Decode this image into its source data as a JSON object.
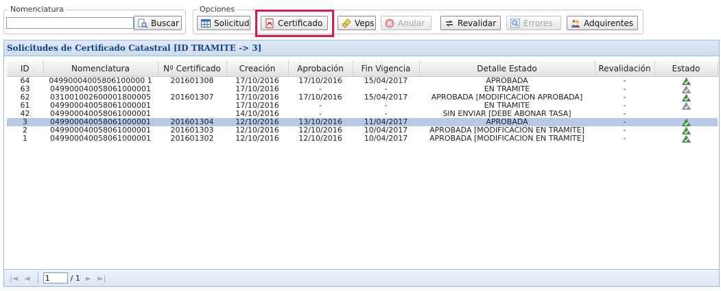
{
  "toolbar": {
    "nomenclatura_legend": "Nomenclatura",
    "nomenclatura_value": "",
    "buscar_label": "Buscar",
    "opciones_legend": "Opciones",
    "buttons": {
      "solicitud": "Solicitud",
      "certificado": "Certificado",
      "veps": "Veps",
      "anular": "Anular",
      "revalidar": "Revalidar",
      "errores": "Errores",
      "adquirentes": "Adquirentes"
    },
    "icons": {
      "buscar": "search-page-icon",
      "solicitud": "table-grid-icon",
      "certificado": "pdf-icon",
      "veps": "ticket-icon",
      "anular": "cancel-icon",
      "revalidar": "refresh-arrows-icon",
      "errores": "error-search-icon",
      "adquirentes": "users-icon"
    }
  },
  "panel": {
    "title": "Solicitudes de Certificado Catastral [ID TRAMITE -> 3]"
  },
  "grid": {
    "columns": [
      "ID",
      "Nomenclatura",
      "Nº Certificado",
      "Creación",
      "Aprobación",
      "Fin Vigencia",
      "Detalle Estado",
      "Revalidación",
      "Estado"
    ],
    "rows": [
      {
        "id": "64",
        "nomenclatura": "04990004005806100000 1",
        "certificado": "201601308",
        "creacion": "17/10/2016",
        "aprobacion": "17/10/2016",
        "fin_vigencia": "15/04/2017",
        "detalle": "APROBADA",
        "revalidacion": "-",
        "estado": "green",
        "selected": false
      },
      {
        "id": "63",
        "nomenclatura": "049900040058061000001",
        "certificado": "",
        "creacion": "17/10/2016",
        "aprobacion": "-",
        "fin_vigencia": "-",
        "detalle": "EN TRAMITE",
        "revalidacion": "-",
        "estado": "gray",
        "selected": false
      },
      {
        "id": "62",
        "nomenclatura": "031001002600001800005",
        "certificado": "201601307",
        "creacion": "17/10/2016",
        "aprobacion": "17/10/2016",
        "fin_vigencia": "15/04/2017",
        "detalle": "APROBADA [MODIFICACION APROBADA]",
        "revalidacion": "-",
        "estado": "green",
        "selected": false
      },
      {
        "id": "61",
        "nomenclatura": "049900040058061000001",
        "certificado": "",
        "creacion": "17/10/2016",
        "aprobacion": "-",
        "fin_vigencia": "-",
        "detalle": "EN TRAMITE",
        "revalidacion": "-",
        "estado": "gray",
        "selected": false
      },
      {
        "id": "42",
        "nomenclatura": "049900040058061000001",
        "certificado": "",
        "creacion": "14/10/2016",
        "aprobacion": "-",
        "fin_vigencia": "-",
        "detalle": "SIN ENVIAR [DEBE ABONAR TASA]",
        "revalidacion": "-",
        "estado": "",
        "selected": false
      },
      {
        "id": "3",
        "nomenclatura": "049900040058061000001",
        "certificado": "201601304",
        "creacion": "12/10/2016",
        "aprobacion": "13/10/2016",
        "fin_vigencia": "11/04/2017",
        "detalle": "APROBADA",
        "revalidacion": "-",
        "estado": "green",
        "selected": true
      },
      {
        "id": "2",
        "nomenclatura": "049900040058061000001",
        "certificado": "201601303",
        "creacion": "12/10/2016",
        "aprobacion": "12/10/2016",
        "fin_vigencia": "10/04/2017",
        "detalle": "APROBADA [MODIFICACION EN TRAMITE]",
        "revalidacion": "-",
        "estado": "green",
        "selected": false
      },
      {
        "id": "1",
        "nomenclatura": "049900040058061000001",
        "certificado": "201601302",
        "creacion": "12/10/2016",
        "aprobacion": "12/10/2016",
        "fin_vigencia": "10/04/2017",
        "detalle": "APROBADA [MODIFICACION EN TRAMITE]",
        "revalidacion": "-",
        "estado": "green",
        "selected": false
      }
    ]
  },
  "pager": {
    "page": "1",
    "of_label": "/ 1"
  },
  "colors": {
    "highlight": "#e8154a",
    "panel_title": "#15428b",
    "selected_row": "#b7c8e6",
    "status_green": "#3c9a3c",
    "status_gray": "#9a9a9a"
  }
}
